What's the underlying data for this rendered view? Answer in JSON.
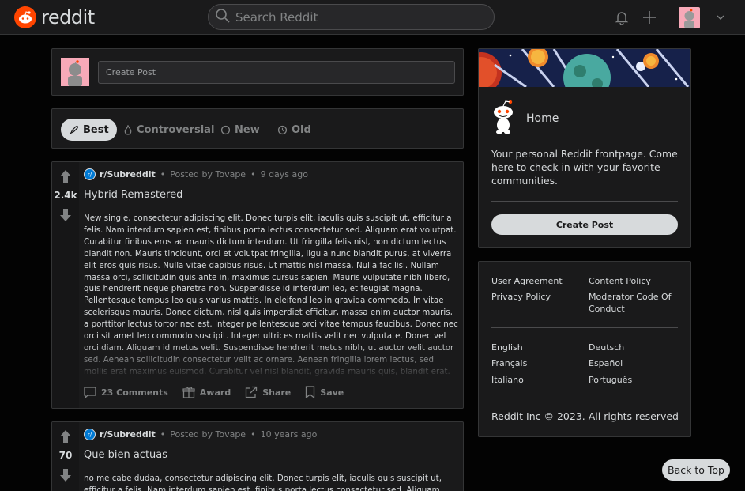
{
  "header": {
    "logo_text": "reddit",
    "search_placeholder": "Search Reddit",
    "icons": [
      "bell-icon",
      "plus-icon",
      "avatar",
      "chevron-down-icon"
    ]
  },
  "create_post": {
    "placeholder": "Create Post"
  },
  "sort_tabs": [
    {
      "label": "Best",
      "icon": "rocket-icon",
      "active": true
    },
    {
      "label": "Controversial",
      "icon": "flame-icon",
      "active": false
    },
    {
      "label": "New",
      "icon": "sparkle-icon",
      "active": false
    },
    {
      "label": "Old",
      "icon": "clock-icon",
      "active": false
    }
  ],
  "posts": [
    {
      "votes": "2.4k",
      "subreddit": "r/Subreddit",
      "author": "Posted by Tovape",
      "time": "9 days ago",
      "title": "Hybrid Remastered",
      "text": "New single, consectetur adipiscing elit. Donec turpis elit, iaculis quis suscipit ut, efficitur a felis. Nam interdum sapien est, finibus porta lectus consectetur sed. Aliquam erat volutpat. Curabitur finibus eros ac mauris dictum interdum. Ut fringilla felis nisl, non dictum lectus blandit non. Mauris tincidunt, orci et volutpat fringilla, ligula nunc blandit purus, at viverra elit eros quis risus. Nulla vitae dapibus risus. Ut mattis nisl massa. Nulla facilisi. Nullam massa orci, sollicitudin quis ante in, maximus cursus sapien. Mauris vulputate nibh libero, quis hendrerit neque pharetra non. Suspendisse id interdum leo, et feugiat magna. Pellentesque tempus leo quis varius mattis. In eleifend leo in gravida commodo. In vitae scelerisque mauris. Donec dictum, nisl quis imperdiet efficitur, massa enim auctor mauris, a porttitor lectus tortor nec est. Integer pellentesque orci vitae tempus faucibus. Donec nec orci sit amet leo commodo suscipit. Integer ultrices mattis velit nec vulputate. Donec vel orci diam. Aliquam id metus velit. Suspendisse hendrerit metus nibh, ut auctor velit auctor sed. Aenean sollicitudin consectetur velit ac ornare. Aenean fringilla lorem lectus, sed mollis erat maximus euismod. Curabitur vel nisl blandit, gravida mauris quis, blandit erat. Vivamus sit amet iaculis",
      "comments": "23 Comments",
      "award": "Award",
      "share": "Share",
      "save": "Save"
    },
    {
      "votes": "70",
      "subreddit": "r/Subreddit",
      "author": "Posted by Tovape",
      "time": "10 years ago",
      "title": "Que bien actuas",
      "text": "no me cabe dudaa, consectetur adipiscing elit. Donec turpis elit, iaculis quis suscipit ut, efficitur a felis. Nam interdum sapien est, finibus porta lectus consectetur sed. Aliquam erat volutpat."
    }
  ],
  "home_card": {
    "title": "Home",
    "description": "Your personal Reddit frontpage. Come here to check in with your favorite communities.",
    "button": "Create Post"
  },
  "links": {
    "col1": [
      "User Agreement",
      "Privacy Policy"
    ],
    "col2": [
      "Content Policy",
      "Moderator Code Of Conduct"
    ],
    "languages_col1": [
      "English",
      "Français",
      "Italiano"
    ],
    "languages_col2": [
      "Deutsch",
      "Español",
      "Português"
    ],
    "copyright": "Reddit Inc © 2023. All rights reserved"
  },
  "back_to_top": "Back to Top",
  "colors": {
    "accent": "#ff4500",
    "background": "#030303",
    "card": "#1a1a1b",
    "border": "#343536",
    "text": "#d7dadc",
    "muted": "#818384"
  }
}
